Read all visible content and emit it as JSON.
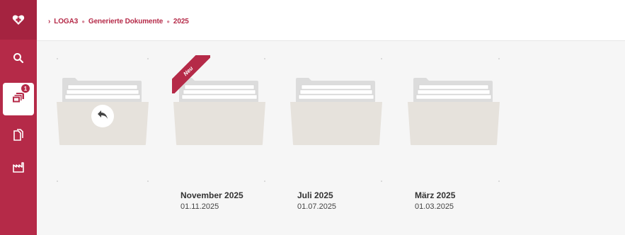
{
  "sidebar": {
    "logo_icon": "heart-cross-logo",
    "items": [
      {
        "name": "search",
        "icon": "search-icon"
      },
      {
        "name": "documents",
        "icon": "document-stack-icon",
        "badge": "1",
        "active": true
      },
      {
        "name": "copies",
        "icon": "copy-icon"
      },
      {
        "name": "factory",
        "icon": "factory-icon"
      }
    ]
  },
  "breadcrumb": {
    "items": [
      "LOGA3",
      "Generierte Dokumente",
      "2025"
    ]
  },
  "folders": [
    {
      "kind": "back",
      "icon": "back-arrow-icon"
    },
    {
      "kind": "folder",
      "title": "November 2025",
      "date": "01.11.2025",
      "ribbon": "Neu"
    },
    {
      "kind": "folder",
      "title": "Juli 2025",
      "date": "01.07.2025"
    },
    {
      "kind": "folder",
      "title": "März 2025",
      "date": "01.03.2025"
    }
  ],
  "colors": {
    "accent": "#b52a48",
    "folder_front": "#e6e2dc",
    "folder_back": "#dcdcdc"
  }
}
